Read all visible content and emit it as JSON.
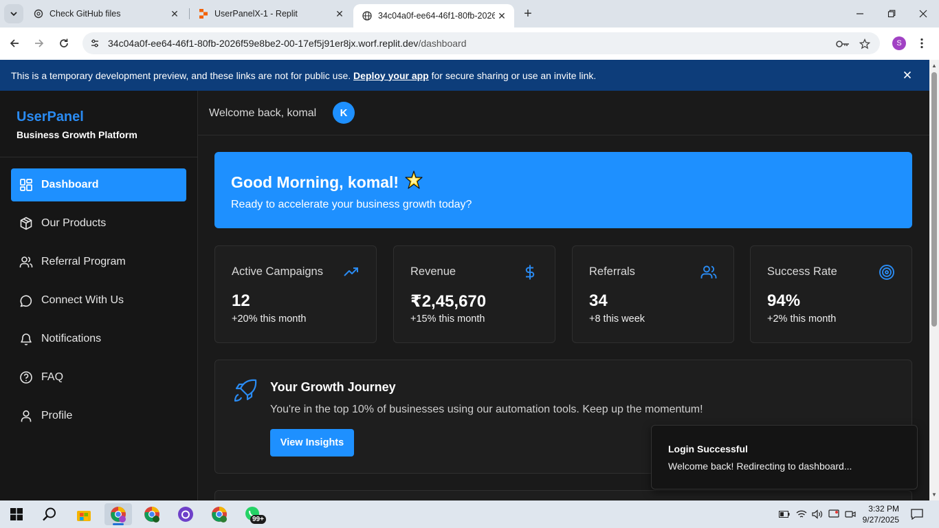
{
  "browser": {
    "tabs": [
      {
        "title": "Check GitHub files",
        "icon": "openai-icon"
      },
      {
        "title": "UserPanelX-1 - Replit",
        "icon": "replit-icon"
      },
      {
        "title": "34c04a0f-ee64-46f1-80fb-2026f59e8be2-00-17ef5j91er8jx.worf.replit.dev",
        "icon": "globe-icon",
        "active": true
      }
    ],
    "url_host": "34c04a0f-ee64-46f1-80fb-2026f59e8be2-00-17ef5j91er8jx.worf.replit.dev",
    "url_path": "/dashboard",
    "profile_initial": "S"
  },
  "banner": {
    "text_before": "This is a temporary development preview, and these links are not for public use. ",
    "link": "Deploy your app",
    "text_after": " for secure sharing or use an invite link."
  },
  "sidebar": {
    "brand_name": "UserPanel",
    "brand_tagline": "Business Growth Platform",
    "items": [
      {
        "label": "Dashboard",
        "icon": "dashboard-icon",
        "active": true
      },
      {
        "label": "Our Products",
        "icon": "box-icon"
      },
      {
        "label": "Referral Program",
        "icon": "users-icon"
      },
      {
        "label": "Connect With Us",
        "icon": "chat-icon"
      },
      {
        "label": "Notifications",
        "icon": "bell-icon"
      },
      {
        "label": "FAQ",
        "icon": "help-icon"
      },
      {
        "label": "Profile",
        "icon": "user-icon"
      }
    ]
  },
  "header": {
    "welcome": "Welcome back, komal",
    "avatar_initial": "K"
  },
  "hero": {
    "title": "Good Morning, komal!",
    "emoji": "🌟",
    "subtitle": "Ready to accelerate your business growth today?"
  },
  "stats": [
    {
      "label": "Active Campaigns",
      "value": "12",
      "change": "+20% this month",
      "icon": "trending-up-icon"
    },
    {
      "label": "Revenue",
      "value": "₹2,45,670",
      "change": "+15% this month",
      "icon": "dollar-icon"
    },
    {
      "label": "Referrals",
      "value": "34",
      "change": "+8 this week",
      "icon": "users-icon"
    },
    {
      "label": "Success Rate",
      "value": "94%",
      "change": "+2% this month",
      "icon": "target-icon"
    }
  ],
  "journey": {
    "title": "Your Growth Journey",
    "text": "You're in the top 10% of businesses using our automation tools. Keep up the momentum!",
    "button": "View Insights"
  },
  "toast": {
    "title": "Login Successful",
    "message": "Welcome back! Redirecting to dashboard..."
  },
  "taskbar": {
    "time": "3:32 PM",
    "date": "9/27/2025",
    "whatsapp_badge": "99+"
  },
  "colors": {
    "accent": "#1e90ff",
    "brand": "#2a8bf2",
    "banner": "#0d3d7a",
    "background": "#1a1a1a",
    "card": "#1e1e1e"
  }
}
